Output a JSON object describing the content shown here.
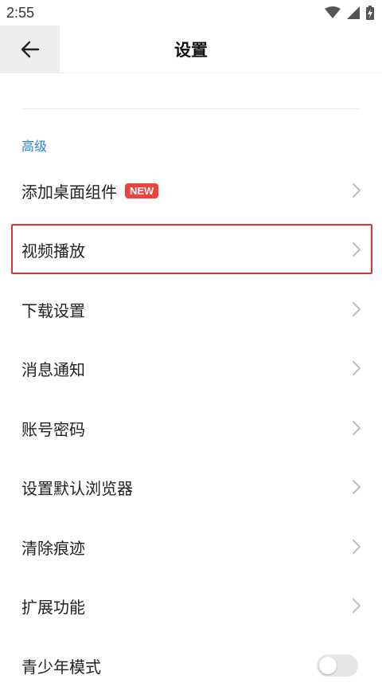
{
  "status_bar": {
    "time": "2:55"
  },
  "header": {
    "title": "设置"
  },
  "section": {
    "title": "高级"
  },
  "items": [
    {
      "label": "添加桌面组件",
      "badge": "NEW"
    },
    {
      "label": "视频播放"
    },
    {
      "label": "下载设置"
    },
    {
      "label": "消息通知"
    },
    {
      "label": "账号密码"
    },
    {
      "label": "设置默认浏览器"
    },
    {
      "label": "清除痕迹"
    },
    {
      "label": "扩展功能"
    },
    {
      "label": "青少年模式",
      "toggle_on": false
    }
  ],
  "colors": {
    "accent": "#2a7de1",
    "badge": "#f2403b",
    "highlight": "#e03030"
  }
}
